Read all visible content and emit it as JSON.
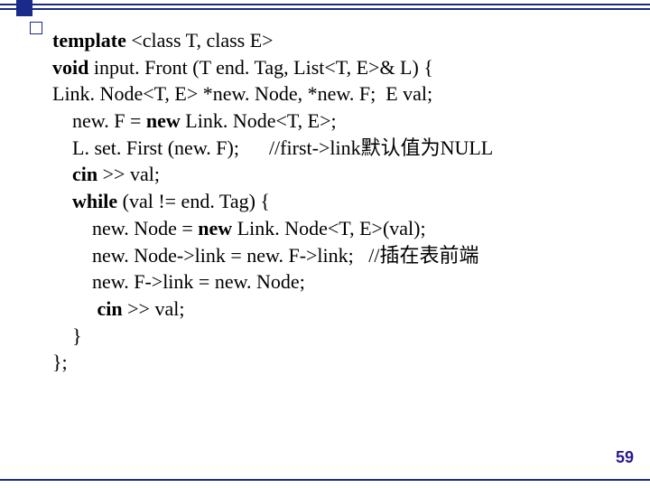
{
  "code": {
    "l1_kw1": "template ",
    "l1_rest": "<class T, class E>",
    "l2_kw1": "void ",
    "l2_rest": "input. Front (T end. Tag, List<T, E>& L) {",
    "l3": "Link. Node<T, E> *new. Node, *new. F;  E val;",
    "l4_pre": "    new. F = ",
    "l4_kw": "new ",
    "l4_post": "Link. Node<T, E>;",
    "l5": "    L. set. First (new. F);      //first->link默认值为NULL",
    "l6_pre": "    ",
    "l6_kw": "cin ",
    "l6_post": ">> val;",
    "l7_pre": "    ",
    "l7_kw": "while ",
    "l7_post": "(val != end. Tag) {",
    "l8_pre": "        new. Node = ",
    "l8_kw": "new ",
    "l8_post": "Link. Node<T, E>(val);",
    "l9": "        new. Node->link = new. F->link;   //插在表前端",
    "l10": "        new. F->link = new. Node;",
    "l11_pre": "        ",
    "l11_kw": " cin ",
    "l11_post": ">> val;",
    "l12": "    }",
    "l13": "};"
  },
  "page_number": "59"
}
